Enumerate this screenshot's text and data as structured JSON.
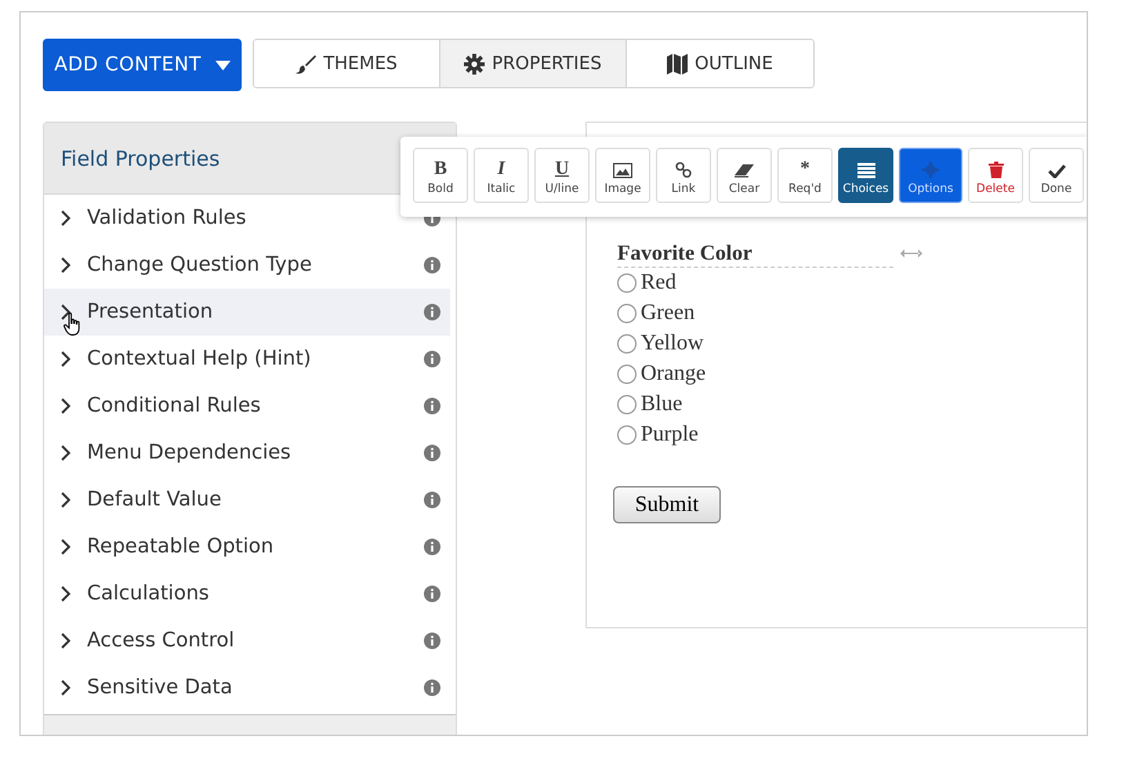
{
  "add_content": {
    "label": "ADD CONTENT"
  },
  "tabs": [
    {
      "label": "THEMES",
      "kind": "brush",
      "selected": false
    },
    {
      "label": "PROPERTIES",
      "kind": "gear",
      "selected": true
    },
    {
      "label": "OUTLINE",
      "kind": "map",
      "selected": false
    }
  ],
  "sidebar": {
    "title": "Field Properties",
    "items": [
      {
        "label": "Validation Rules",
        "hovered": false
      },
      {
        "label": "Change Question Type",
        "hovered": false
      },
      {
        "label": "Presentation",
        "hovered": true
      },
      {
        "label": "Contextual Help (Hint)",
        "hovered": false
      },
      {
        "label": "Conditional Rules",
        "hovered": false
      },
      {
        "label": "Menu Dependencies",
        "hovered": false
      },
      {
        "label": "Default Value",
        "hovered": false
      },
      {
        "label": "Repeatable Option",
        "hovered": false
      },
      {
        "label": "Calculations",
        "hovered": false
      },
      {
        "label": "Access Control",
        "hovered": false
      },
      {
        "label": "Sensitive Data",
        "hovered": false
      }
    ]
  },
  "toolbar": [
    {
      "kind": "letter",
      "glyph": "B",
      "label": "Bold",
      "selected": false,
      "focused": false
    },
    {
      "kind": "letter-italic",
      "glyph": "I",
      "label": "Italic",
      "selected": false,
      "focused": false
    },
    {
      "kind": "letter-underline",
      "glyph": "U",
      "label": "U/line",
      "selected": false,
      "focused": false
    },
    {
      "kind": "image",
      "label": "Image",
      "selected": false,
      "focused": false
    },
    {
      "kind": "link",
      "label": "Link",
      "selected": false,
      "focused": false
    },
    {
      "kind": "eraser",
      "label": "Clear",
      "selected": false,
      "focused": false
    },
    {
      "kind": "letter",
      "glyph": "*",
      "label": "Req'd",
      "selected": false,
      "focused": false
    },
    {
      "kind": "list",
      "label": "Choices",
      "selected": true,
      "focused": false
    },
    {
      "kind": "gear",
      "label": "Options",
      "selected": false,
      "focused": true
    },
    {
      "kind": "trash",
      "label": "Delete",
      "selected": false,
      "focused": false
    },
    {
      "kind": "check",
      "label": "Done",
      "selected": false,
      "focused": false
    }
  ],
  "question": {
    "label": "Favorite Color",
    "choices": [
      {
        "label": "Red",
        "selected": false
      },
      {
        "label": "Green",
        "selected": false
      },
      {
        "label": "Yellow",
        "selected": false
      },
      {
        "label": "Orange",
        "selected": false
      },
      {
        "label": "Blue",
        "selected": false
      },
      {
        "label": "Purple",
        "selected": false
      }
    ]
  },
  "submit": {
    "label": "Submit"
  }
}
